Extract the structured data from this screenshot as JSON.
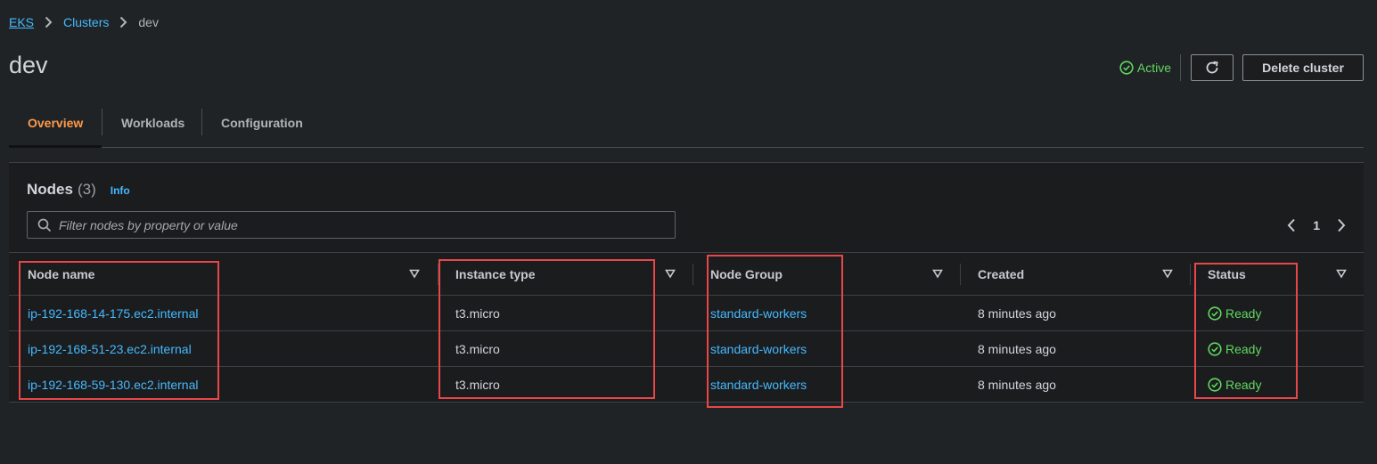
{
  "breadcrumb": {
    "items": [
      {
        "label": "EKS",
        "link": true
      },
      {
        "label": "Clusters",
        "link": true
      },
      {
        "label": "dev",
        "link": false
      }
    ]
  },
  "header": {
    "title": "dev",
    "status": "Active",
    "refresh_icon": "refresh-icon",
    "delete_label": "Delete cluster"
  },
  "tabs": [
    {
      "label": "Overview",
      "active": true
    },
    {
      "label": "Workloads",
      "active": false
    },
    {
      "label": "Configuration",
      "active": false
    }
  ],
  "nodes": {
    "title": "Nodes",
    "count": "(3)",
    "info_label": "Info",
    "filter_placeholder": "Filter nodes by property or value",
    "filter_value": "",
    "pagination": {
      "current_page": "1"
    },
    "columns": [
      "Node name",
      "Instance type",
      "Node Group",
      "Created",
      "Status"
    ],
    "rows": [
      {
        "node_name": "ip-192-168-14-175.ec2.internal",
        "instance_type": "t3.micro",
        "node_group": "standard-workers",
        "created": "8 minutes ago",
        "status": "Ready"
      },
      {
        "node_name": "ip-192-168-51-23.ec2.internal",
        "instance_type": "t3.micro",
        "node_group": "standard-workers",
        "created": "8 minutes ago",
        "status": "Ready"
      },
      {
        "node_name": "ip-192-168-59-130.ec2.internal",
        "instance_type": "t3.micro",
        "node_group": "standard-workers",
        "created": "8 minutes ago",
        "status": "Ready"
      }
    ]
  },
  "colors": {
    "link": "#44b9ff",
    "active_tab": "#ff9a4a",
    "success": "#5fd75f",
    "highlight": "#e8474a"
  }
}
